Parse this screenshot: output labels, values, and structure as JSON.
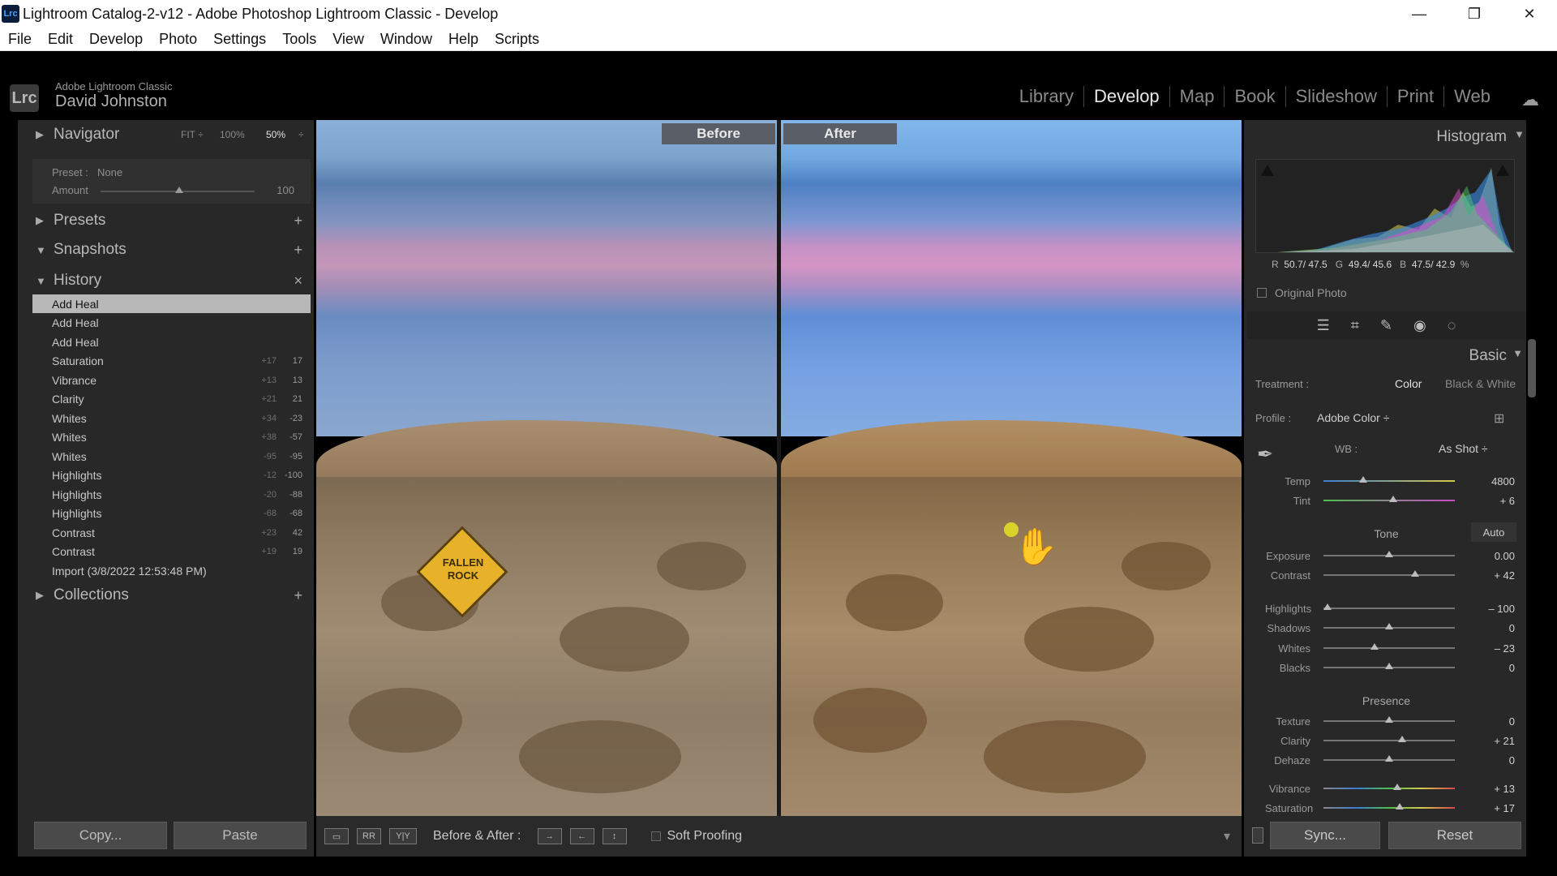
{
  "window": {
    "title": "Lightroom Catalog-2-v12 - Adobe Photoshop Lightroom Classic - Develop",
    "app_icon": "Lrc",
    "min": "—",
    "max": "❐",
    "close": "✕"
  },
  "menu": [
    "File",
    "Edit",
    "Develop",
    "Photo",
    "Settings",
    "Tools",
    "View",
    "Window",
    "Help",
    "Scripts"
  ],
  "identity": {
    "logo": "Lrc",
    "brand": "Adobe Lightroom Classic",
    "user": "David Johnston"
  },
  "modules": [
    "Library",
    "Develop",
    "Map",
    "Book",
    "Slideshow",
    "Print",
    "Web"
  ],
  "active_module": "Develop",
  "navigator": {
    "label": "Navigator",
    "fit": "FIT ÷",
    "z100": "100%",
    "z50": "50%",
    "zmore": "÷"
  },
  "preset_box": {
    "preset_label": "Preset :",
    "preset_value": "None",
    "amount_label": "Amount",
    "amount_value": "100"
  },
  "presets": {
    "label": "Presets"
  },
  "snapshots": {
    "label": "Snapshots"
  },
  "history": {
    "label": "History",
    "items": [
      {
        "name": "Add Heal",
        "delta": "",
        "value": ""
      },
      {
        "name": "Add Heal",
        "delta": "",
        "value": ""
      },
      {
        "name": "Add Heal",
        "delta": "",
        "value": ""
      },
      {
        "name": "Saturation",
        "delta": "+17",
        "value": "17"
      },
      {
        "name": "Vibrance",
        "delta": "+13",
        "value": "13"
      },
      {
        "name": "Clarity",
        "delta": "+21",
        "value": "21"
      },
      {
        "name": "Whites",
        "delta": "+34",
        "value": "-23"
      },
      {
        "name": "Whites",
        "delta": "+38",
        "value": "-57"
      },
      {
        "name": "Whites",
        "delta": "-95",
        "value": "-95"
      },
      {
        "name": "Highlights",
        "delta": "-12",
        "value": "-100"
      },
      {
        "name": "Highlights",
        "delta": "-20",
        "value": "-88"
      },
      {
        "name": "Highlights",
        "delta": "-68",
        "value": "-68"
      },
      {
        "name": "Contrast",
        "delta": "+23",
        "value": "42"
      },
      {
        "name": "Contrast",
        "delta": "+19",
        "value": "19"
      },
      {
        "name": "Import (3/8/2022 12:53:48 PM)",
        "delta": "",
        "value": ""
      }
    ]
  },
  "collections": {
    "label": "Collections"
  },
  "left_buttons": {
    "copy": "Copy...",
    "paste": "Paste"
  },
  "view": {
    "before": "Before",
    "after": "After",
    "sign": "FALLEN ROCK"
  },
  "toolbar": {
    "ba_label": "Before & After :",
    "soft_proofing": "Soft Proofing",
    "yy": "Y|Y"
  },
  "histogram": {
    "title": "Histogram",
    "r_label": "R",
    "r_value": "50.7/ 47.5",
    "g_label": "G",
    "g_value": "49.4/ 45.6",
    "b_label": "B",
    "b_value": "47.5/ 42.9",
    "pct": "%",
    "original_photo": "Original Photo"
  },
  "basic": {
    "title": "Basic",
    "treatment_label": "Treatment :",
    "treatment_color": "Color",
    "treatment_bw": "Black & White",
    "profile_label": "Profile :",
    "profile_value": "Adobe Color ÷",
    "wb_label": "WB :",
    "wb_value": "As Shot ÷",
    "tone_label": "Tone",
    "auto": "Auto",
    "presence_label": "Presence"
  },
  "sliders": [
    {
      "label": "Temp",
      "value": "4800",
      "pos": 0.3
    },
    {
      "label": "Tint",
      "value": "+ 6",
      "pos": 0.53
    },
    {
      "label": "Exposure",
      "value": "0.00",
      "pos": 0.5
    },
    {
      "label": "Contrast",
      "value": "+ 42",
      "pos": 0.7
    },
    {
      "label": "Highlights",
      "value": "– 100",
      "pos": 0.03
    },
    {
      "label": "Shadows",
      "value": "0",
      "pos": 0.5
    },
    {
      "label": "Whites",
      "value": "– 23",
      "pos": 0.39
    },
    {
      "label": "Blacks",
      "value": "0",
      "pos": 0.5
    },
    {
      "label": "Texture",
      "value": "0",
      "pos": 0.5
    },
    {
      "label": "Clarity",
      "value": "+ 21",
      "pos": 0.6
    },
    {
      "label": "Dehaze",
      "value": "0",
      "pos": 0.5
    },
    {
      "label": "Vibrance",
      "value": "+ 13",
      "pos": 0.56
    },
    {
      "label": "Saturation",
      "value": "+ 17",
      "pos": 0.58
    }
  ],
  "right_buttons": {
    "sync": "Sync...",
    "reset": "Reset"
  }
}
